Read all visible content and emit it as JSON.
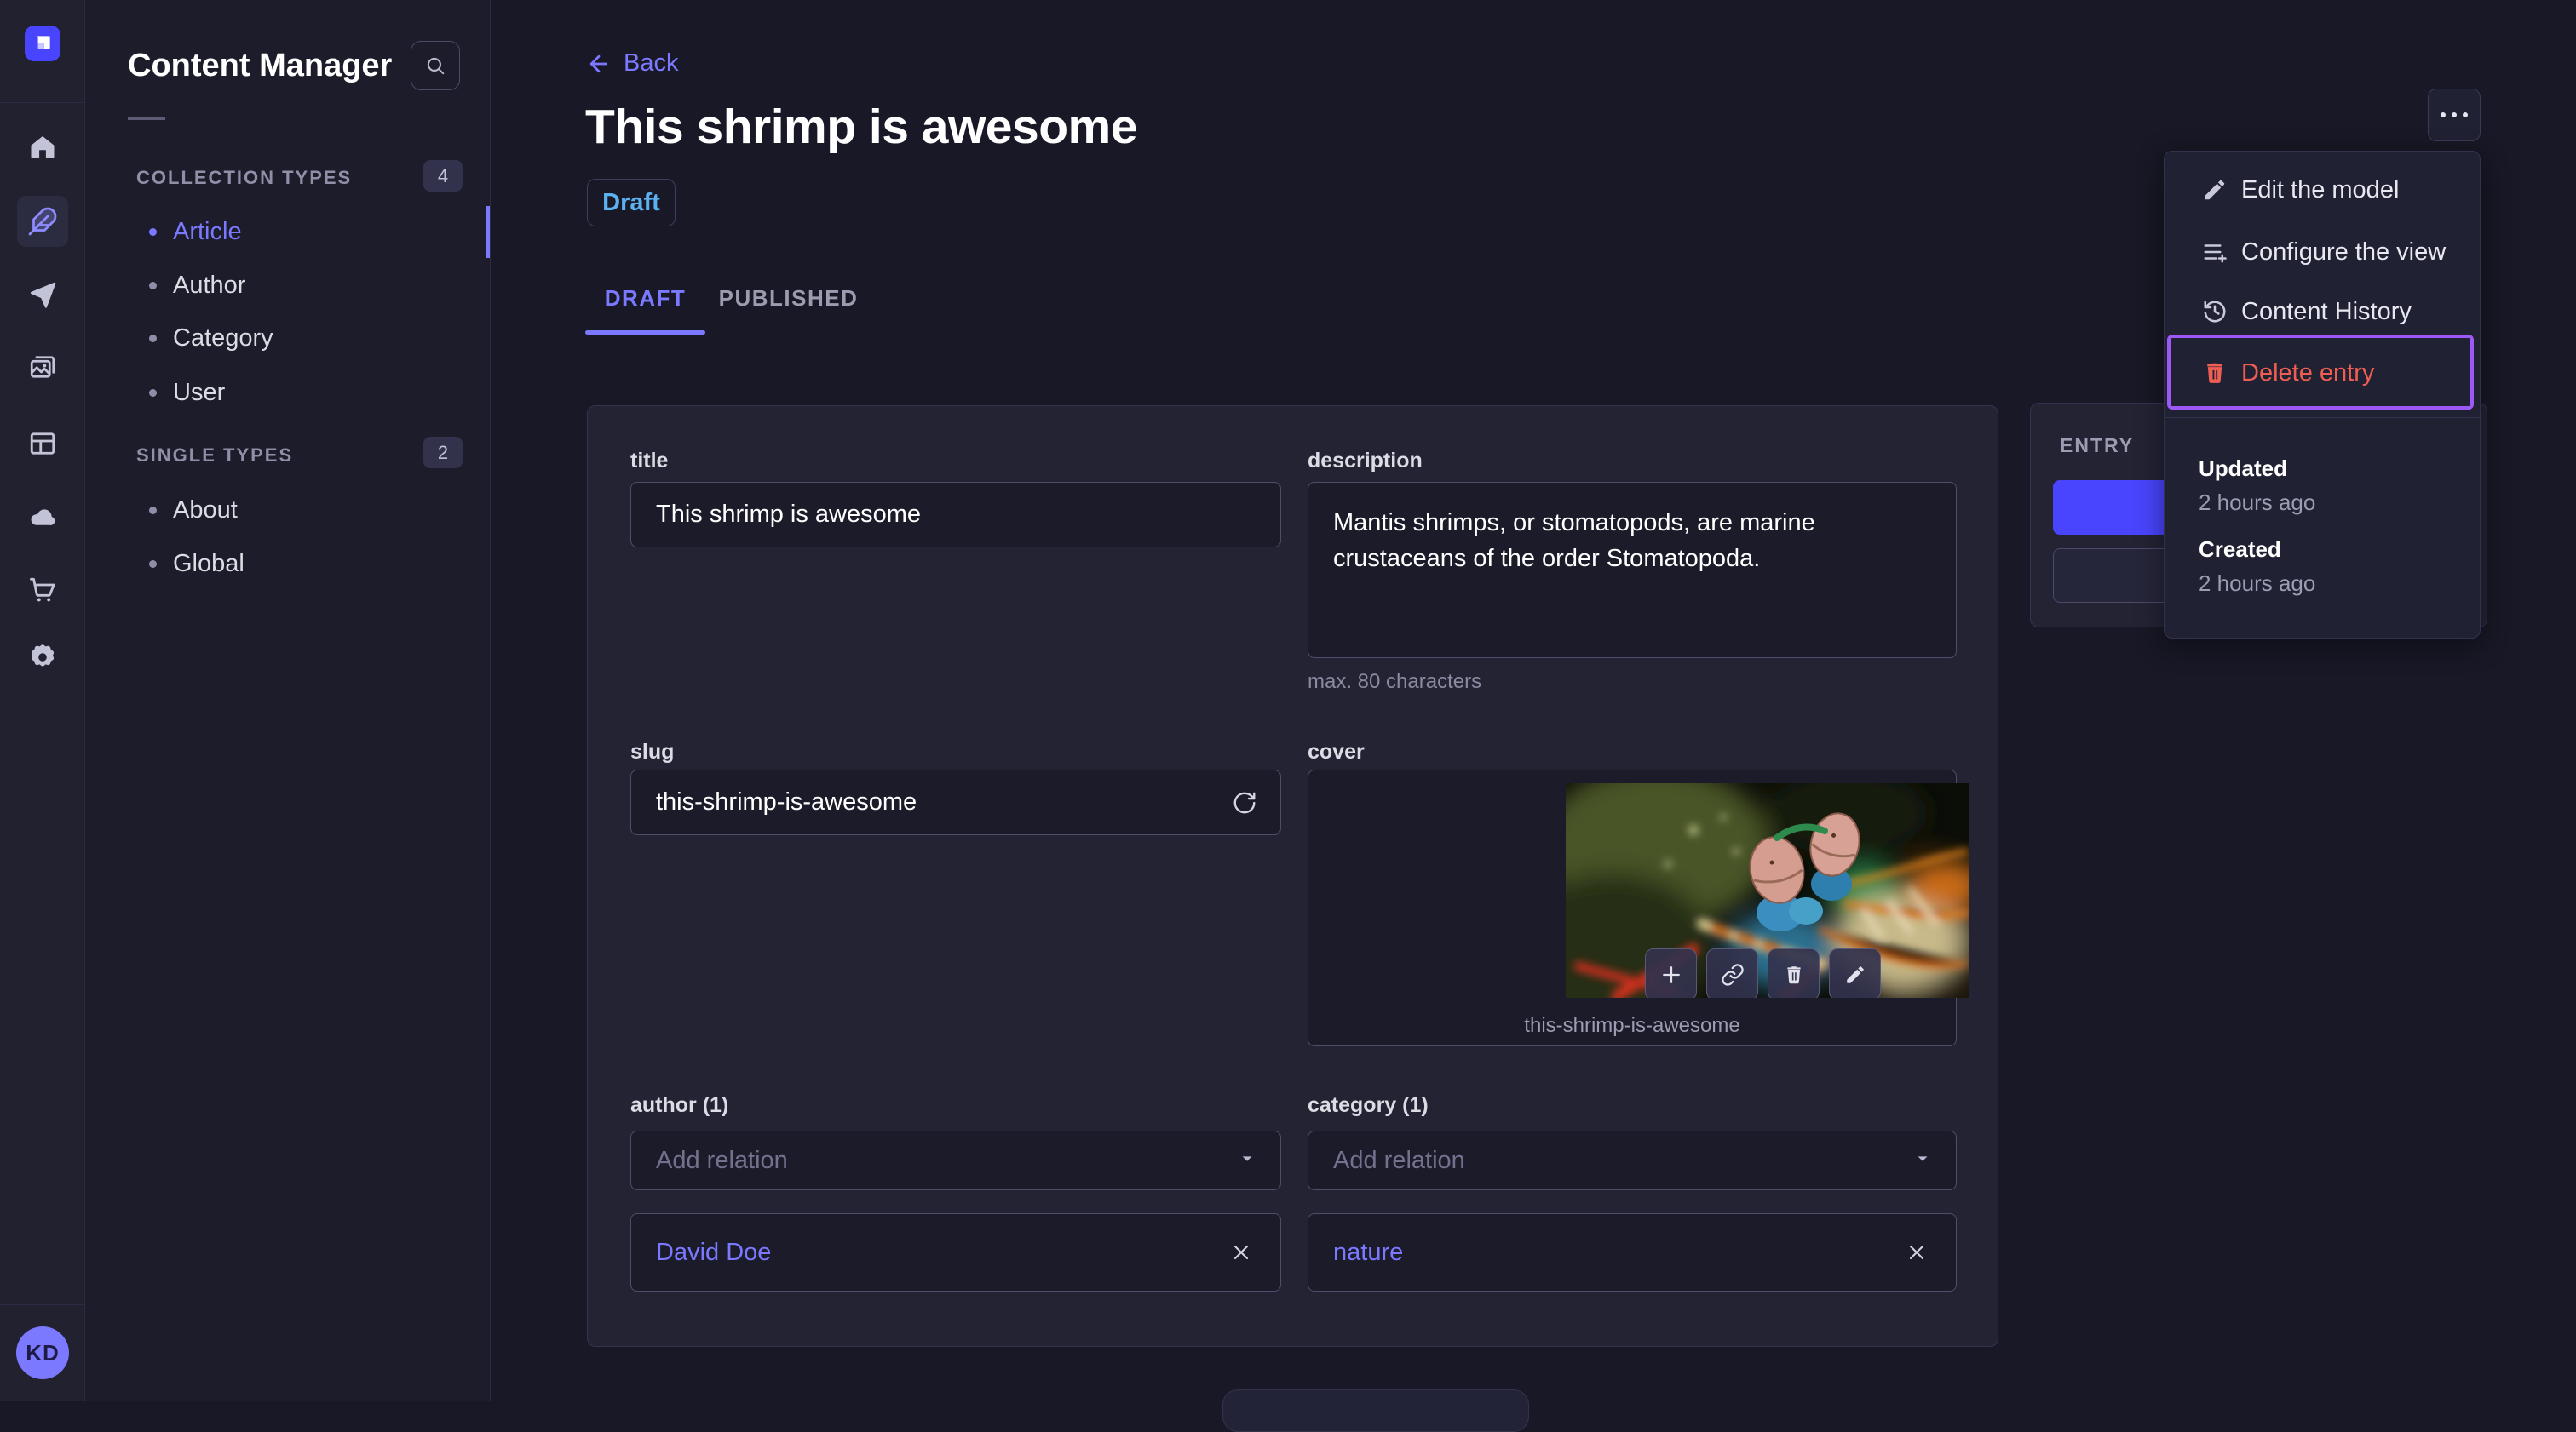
{
  "app": {
    "avatar_initials": "KD",
    "rail_icons": [
      "strapi-logo",
      "home",
      "content-feather",
      "release-send",
      "media-images",
      "content-type-layout",
      "deploy-cloud",
      "marketplace-cart",
      "settings-gear"
    ]
  },
  "sidebar": {
    "title": "Content Manager",
    "search_icon": "magnifier",
    "sections": [
      {
        "label": "COLLECTION TYPES",
        "count": "4",
        "items": [
          "Article",
          "Author",
          "Category",
          "User"
        ],
        "active_item": "Article"
      },
      {
        "label": "SINGLE TYPES",
        "count": "2",
        "items": [
          "About",
          "Global"
        ]
      }
    ]
  },
  "header": {
    "back_label": "Back",
    "title": "This shrimp is awesome",
    "status": "Draft",
    "tabs": [
      {
        "label": "DRAFT",
        "active": true
      },
      {
        "label": "PUBLISHED",
        "active": false
      }
    ],
    "more_icon": "ellipsis"
  },
  "form": {
    "title": {
      "label": "title",
      "value": "This shrimp is awesome"
    },
    "description": {
      "label": "description",
      "value": "Mantis shrimps, or stomatopods, are marine crustaceans of the order Stomatopoda.",
      "hint": "max. 80 characters"
    },
    "slug": {
      "label": "slug",
      "value": "this-shrimp-is-awesome",
      "action_icon": "regenerate"
    },
    "cover": {
      "label": "cover",
      "caption": "this-shrimp-is-awesome",
      "action_icons": [
        "add",
        "copy-link",
        "delete",
        "edit"
      ]
    },
    "author": {
      "label": "author (1)",
      "placeholder": "Add relation",
      "relation": "David Doe"
    },
    "category": {
      "label": "category (1)",
      "placeholder": "Add relation",
      "relation": "nature"
    }
  },
  "entry_panel": {
    "label": "ENTRY"
  },
  "menu": {
    "items": [
      {
        "label": "Edit the model",
        "icon": "pencil"
      },
      {
        "label": "Configure the view",
        "icon": "list-configure"
      },
      {
        "label": "Content History",
        "icon": "history-clock"
      },
      {
        "label": "Delete entry",
        "icon": "trash",
        "danger": true,
        "highlighted": true
      }
    ],
    "meta": [
      {
        "label": "Updated",
        "value": "2 hours ago"
      },
      {
        "label": "Created",
        "value": "2 hours ago"
      }
    ]
  },
  "colors": {
    "primary": "#4945ff",
    "primary_light": "#7b79ff",
    "draft_status": "#5cb1f0",
    "danger": "#ee5e52",
    "highlight": "#9c59f5",
    "background": "#181826",
    "surface": "#232334"
  }
}
